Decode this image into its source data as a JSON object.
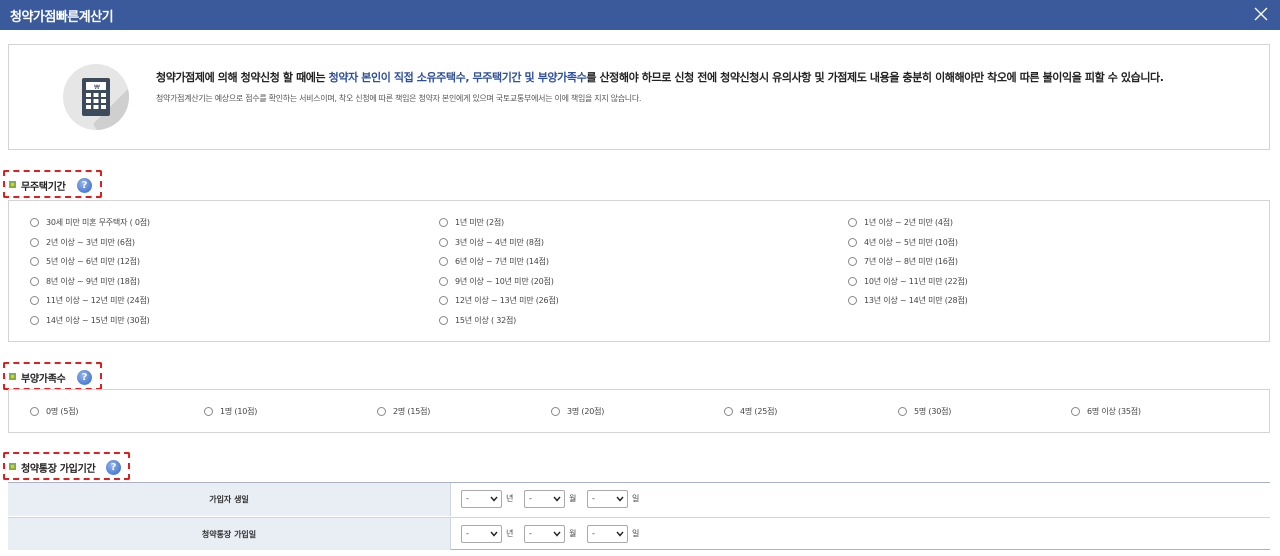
{
  "window": {
    "title": "청약가점빠른계산기",
    "close_icon": "close-icon"
  },
  "notice": {
    "line1_pre": "청약가점제에 의해 청약신청 할 때에는 ",
    "line1_highlight": "청약자 본인이 직접 소유주택수, 무주택기간 및 부양가족수",
    "line1_post": "를 산정해야 하므로 신청 전에 청약신청시 유의사항 및 가점제도 내용을 충분히 이해해야만 착오에 따른 불이익을 피할 수 있습니다.",
    "line2": "청약가점계산기는 예상으로 점수를 확인하는 서비스이며, 착오 신청에 따른 책임은 청약자 본인에게 있으며 국토교통부에서는 이에 책임을 지지 않습니다.",
    "icon": "calculator-icon"
  },
  "sections": {
    "homeless": {
      "title": "무주택기간",
      "options": [
        "30세 미만 미혼 무주택자 ( 0점)",
        "1년 미만 (2점)",
        "1년 이상 ~ 2년 미만 (4점)",
        "2년 이상 ~ 3년 미만 (6점)",
        "3년 이상 ~ 4년 미만 (8점)",
        "4년 이상 ~ 5년 미만 (10점)",
        "5년 이상 ~ 6년 미만 (12점)",
        "6년 이상 ~ 7년 미만 (14점)",
        "7년 이상 ~ 8년 미만 (16점)",
        "8년 이상 ~ 9년 미만 (18점)",
        "9년 이상 ~ 10년 미만 (20점)",
        "10년 이상 ~ 11년 미만 (22점)",
        "11년 이상 ~ 12년 미만 (24점)",
        "12년 이상 ~ 13년 미만 (26점)",
        "13년 이상 ~ 14년 미만 (28점)",
        "14년 이상 ~ 15년 미만 (30점)",
        "15년 이상 ( 32점)"
      ]
    },
    "dependents": {
      "title": "부양가족수",
      "options": [
        "0명 (5점)",
        "1명 (10점)",
        "2명 (15점)",
        "3명 (20점)",
        "4명 (25점)",
        "5명 (30점)",
        "6명 이상 (35점)"
      ]
    },
    "account": {
      "title": "청약통장 가입기간",
      "rows": [
        {
          "label": "가입자 생일",
          "year": "-",
          "month": "-",
          "day": "-"
        },
        {
          "label": "청약통장 가입일",
          "year": "-",
          "month": "-",
          "day": "-"
        }
      ],
      "units": {
        "year": "년",
        "month": "월",
        "day": "일"
      }
    }
  },
  "help_label": "?",
  "colors": {
    "titlebar": "#3a5a9b",
    "highlight": "#2e4f9a",
    "dashed_border": "#e02020"
  }
}
